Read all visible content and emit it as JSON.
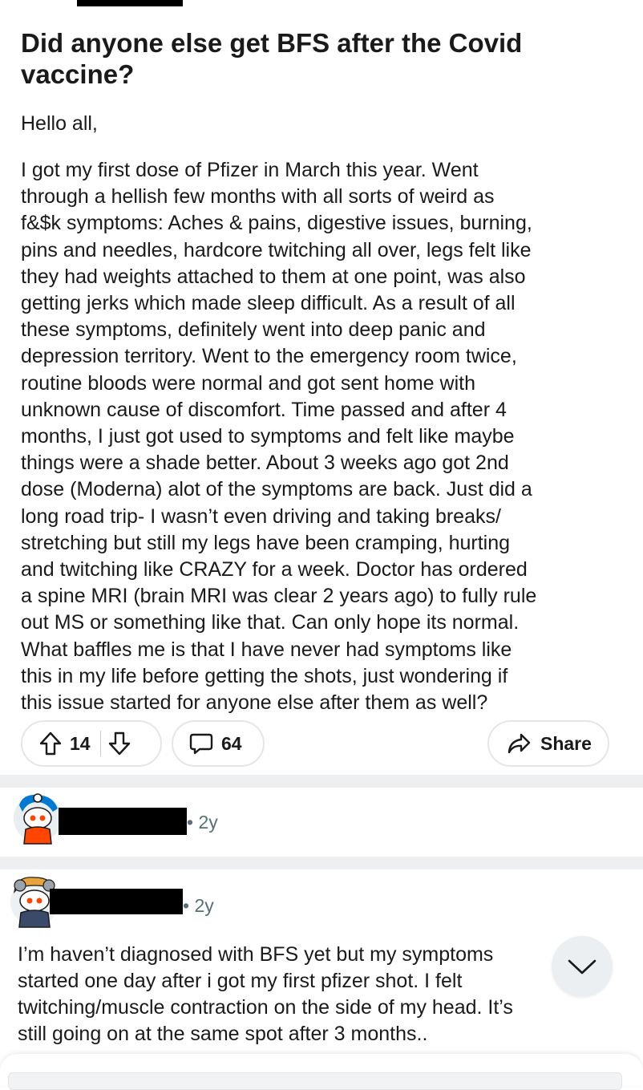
{
  "post": {
    "title": "Did anyone else get BFS after the Covid vaccine?",
    "greeting": "Hello all,",
    "body": "I got my first dose of Pfizer in March this year. Went\nthrough a hellish few months with all sorts of weird as\nf&$k symptoms: Aches & pains, digestive issues, burning,\npins and needles, hardcore twitching all over, legs felt like\nthey had weights attached to them at one point, was also\ngetting jerks which made sleep difficult. As a result of all\nthese symptoms, definitely went into deep panic and\ndepression territory. Went to the emergency room twice,\nroutine bloods were normal and got sent home with\nunknown cause of discomfort. Time passed and after 4\nmonths, I just got used to symptoms and felt like maybe\nthings were a shade better. About 3 weeks ago got 2nd\ndose (Moderna) alot of the symptoms are back. Just did a\nlong road trip- I wasn’t even driving and taking breaks/\nstretching but still my legs have been cramping, hurting\nand twitching like CRAZY for a week. Doctor has ordered\na spine MRI  (brain MRI was clear 2 years ago) to fully rule\nout MS or something like that. Can only hope its normal.\nWhat baffles me is that I have never had symptoms like\nthis in my life before getting the shots, just wondering if\nthis issue started for anyone else after them as well?"
  },
  "actions": {
    "upvotes": "14",
    "comments": "64",
    "share_label": "Share"
  },
  "comments": [
    {
      "age": "• 2y"
    },
    {
      "age": "• 2y",
      "text": "I’m haven’t diagnosed with BFS yet but my symptoms\nstarted one day after i got my first pfizer shot. I felt\ntwitching/muscle contraction on the side of my head. It’s\nstill going on at the same spot after 3 months.."
    }
  ],
  "icons": {
    "upvote": "arrow-up-icon",
    "downvote": "arrow-down-icon",
    "comment": "comment-bubble-icon",
    "share": "share-arrow-icon",
    "collapse": "chevron-down-icon"
  },
  "colors": {
    "text": "#1a1a1b",
    "muted": "#576f76",
    "border": "#e4e6e8",
    "divider": "#edeff1",
    "avatar_accent": "#0079d3",
    "avatar_red": "#ff4500"
  }
}
